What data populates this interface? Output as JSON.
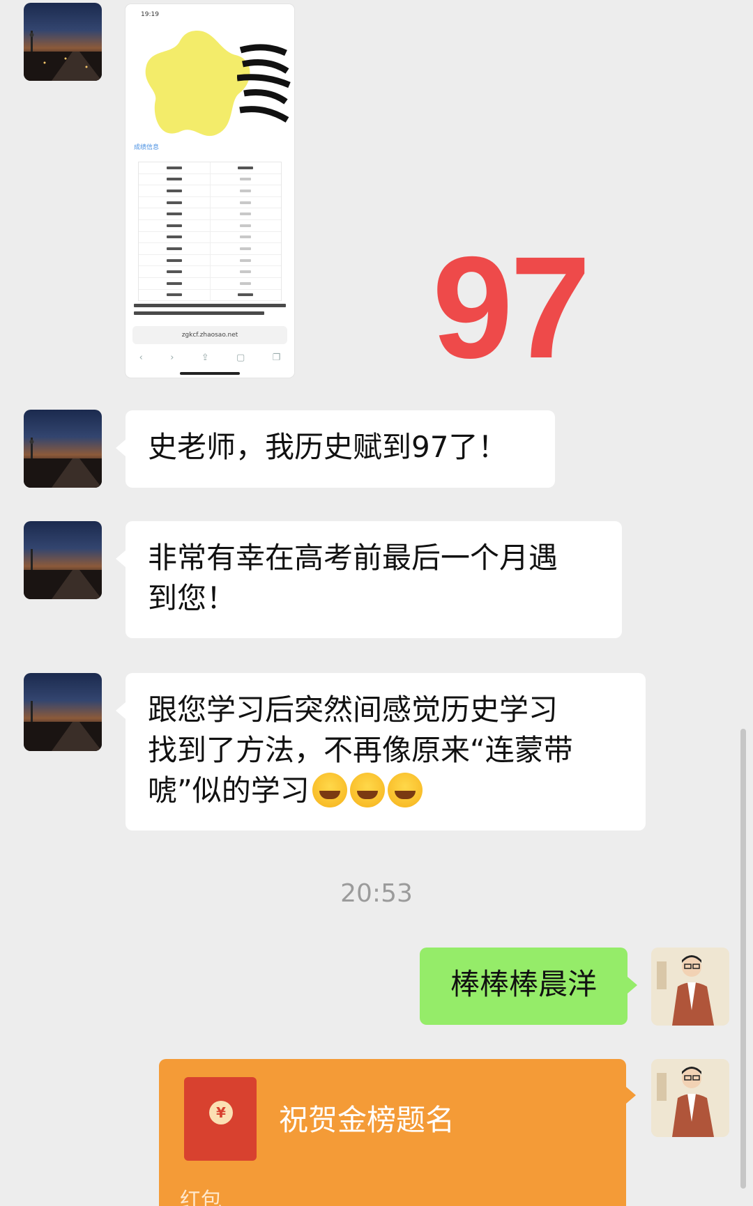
{
  "image_message": {
    "status_time": "19:19",
    "link_label": "成绩信息",
    "url": "zgkcf.zhaosao.net"
  },
  "overlay_number": "97",
  "messages": [
    {
      "text": "史老师，我历史赋到97了！"
    },
    {
      "text_lines": [
        "非常有幸在高考前最后一个月遇",
        "到您！"
      ]
    },
    {
      "text_lines": [
        "跟您学习后突然间感觉历史学习",
        "找到了方法，不再像原来“连蒙带",
        "唬”似的学习"
      ]
    }
  ],
  "timestamp": "20:53",
  "my_message": "棒棒棒晨洋",
  "red_packet": {
    "title": "祝贺金榜题名",
    "kind": "红包",
    "symbol": "¥"
  },
  "colors": {
    "my_bubble": "#95ec69",
    "red_packet": "#f49b37",
    "number": "#ee4a4a"
  }
}
